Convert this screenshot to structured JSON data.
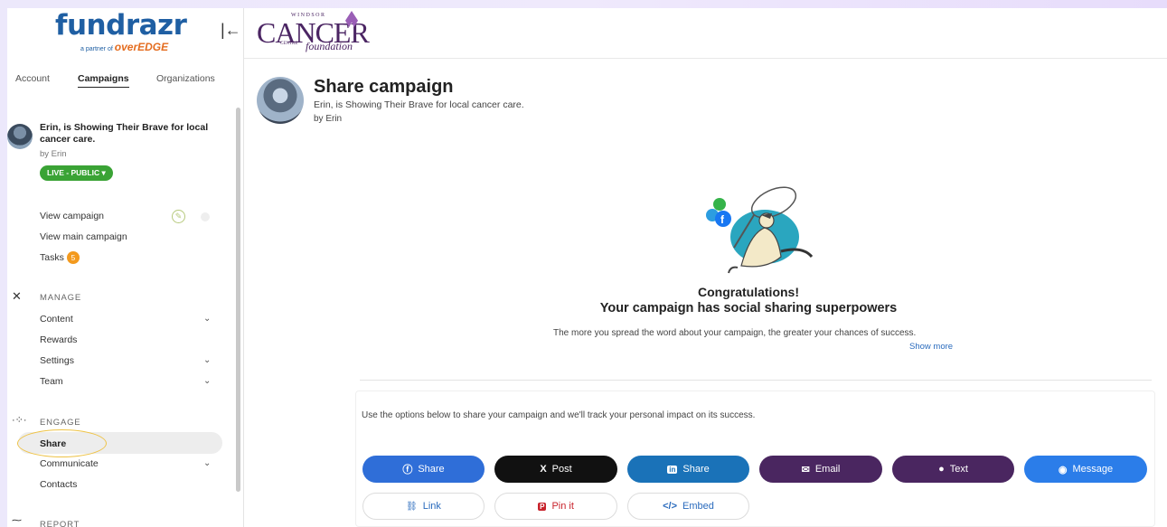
{
  "brand": {
    "name_a": "fund",
    "name_b": "razr",
    "partner": "a partner of",
    "partner_brand": "overEDGE"
  },
  "org": {
    "windsor": "WINDSOR",
    "cancer": "CANCER",
    "centre": "CENTRE",
    "foundation": "foundation"
  },
  "tabs": [
    {
      "label": "Account"
    },
    {
      "label": "Campaigns"
    },
    {
      "label": "Organizations"
    }
  ],
  "campaign": {
    "title": "Erin, is Showing Their Brave for local cancer care.",
    "by": "by Erin",
    "status": "LIVE - PUBLIC ▾"
  },
  "links": {
    "view_campaign": "View campaign",
    "view_main": "View main campaign",
    "tasks": "Tasks",
    "tasks_count": "5"
  },
  "manage": {
    "heading": "MANAGE",
    "items": [
      "Content",
      "Rewards",
      "Settings",
      "Team"
    ]
  },
  "engage": {
    "heading": "ENGAGE",
    "items": [
      "Share",
      "Communicate",
      "Contacts"
    ]
  },
  "report": {
    "heading": "REPORT"
  },
  "page": {
    "title": "Share campaign",
    "subtitle": "Erin, is Showing Their Brave for local cancer care.",
    "by": "by Erin"
  },
  "hero": {
    "line1": "Congratulations!",
    "line2": "Your campaign has social sharing superpowers",
    "desc": "The more you spread the word about your campaign, the greater your chances of success.",
    "show_more": "Show more"
  },
  "options_text": "Use the options below to share your campaign and we'll track your personal impact on its success.",
  "buttons": [
    {
      "label": "Share",
      "icon": "f",
      "color": "#2f6ed8"
    },
    {
      "label": "Post",
      "icon": "X",
      "color": "#111111"
    },
    {
      "label": "Share",
      "icon": "in",
      "color": "#1a72b8"
    },
    {
      "label": "Email",
      "icon": "✉",
      "color": "#4a2660"
    },
    {
      "label": "Text",
      "icon": "💬",
      "color": "#4a2660"
    },
    {
      "label": "Message",
      "icon": "◉",
      "color": "#2b7de9"
    }
  ],
  "outline_buttons": [
    {
      "label": "Link",
      "icon": "🔗",
      "color": "#2a6bbd"
    },
    {
      "label": "Pin it",
      "icon": "P",
      "color": "#c8232c"
    },
    {
      "label": "Embed",
      "icon": "</>",
      "color": "#2a6bbd"
    }
  ]
}
